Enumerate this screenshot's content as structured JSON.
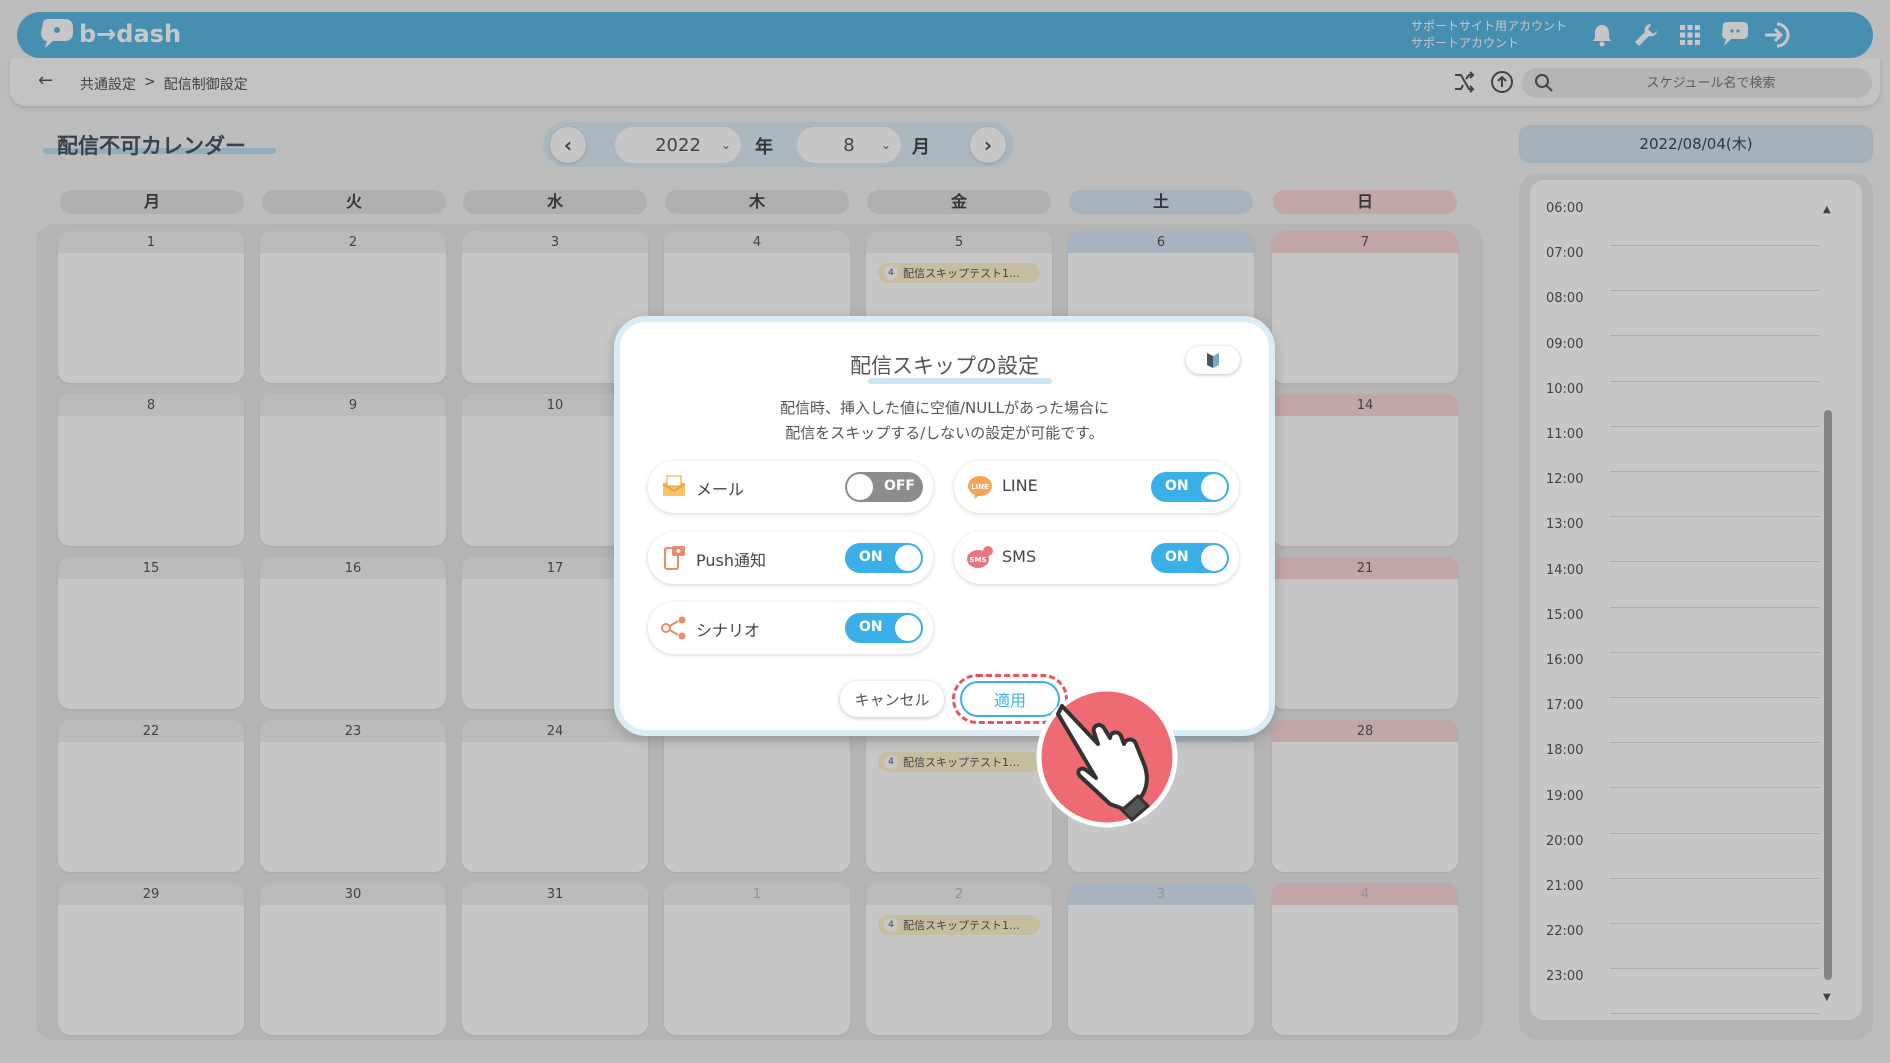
{
  "header": {
    "logo_text": "b→dash",
    "account_line1": "サポートサイト用アカウント",
    "account_line2": "サポートアカウント",
    "icons": [
      "bell-icon",
      "wrench-icon",
      "grid-icon",
      "chat-icon",
      "logout-icon"
    ]
  },
  "breadcrumb": {
    "back_icon": "arrow-left-icon",
    "item1": "共通設定",
    "separator": ">",
    "item2": "配信制御設定"
  },
  "toolbar": {
    "search_placeholder": "スケジュール名で検索"
  },
  "calendar": {
    "title": "配信不可カレンダー",
    "year": "2022",
    "year_label": "年",
    "month": "8",
    "month_label": "月",
    "weekdays": [
      "月",
      "火",
      "水",
      "木",
      "金",
      "土",
      "日"
    ],
    "weeks": [
      [
        {
          "d": "1"
        },
        {
          "d": "2"
        },
        {
          "d": "3"
        },
        {
          "d": "4"
        },
        {
          "d": "5",
          "event": "配信スキップテスト1…",
          "count": "4"
        },
        {
          "d": "6"
        },
        {
          "d": "7"
        }
      ],
      [
        {
          "d": "8"
        },
        {
          "d": "9"
        },
        {
          "d": "10"
        },
        {
          "d": ""
        },
        {
          "d": ""
        },
        {
          "d": ""
        },
        {
          "d": "14"
        }
      ],
      [
        {
          "d": "15"
        },
        {
          "d": "16"
        },
        {
          "d": "17"
        },
        {
          "d": ""
        },
        {
          "d": ""
        },
        {
          "d": ""
        },
        {
          "d": "21"
        }
      ],
      [
        {
          "d": "22"
        },
        {
          "d": "23"
        },
        {
          "d": "24"
        },
        {
          "d": ""
        },
        {
          "d": "",
          "event": "配信スキップテスト1…",
          "count": "4"
        },
        {
          "d": ""
        },
        {
          "d": "28"
        }
      ],
      [
        {
          "d": "29"
        },
        {
          "d": "30"
        },
        {
          "d": "31"
        },
        {
          "d": "1",
          "other": true
        },
        {
          "d": "2",
          "other": true,
          "event": "配信スキップテスト1…",
          "count": "4"
        },
        {
          "d": "3",
          "other": true
        },
        {
          "d": "4",
          "other": true
        }
      ]
    ]
  },
  "schedule": {
    "date": "2022/08/04(木)",
    "hours": [
      "06:00",
      "07:00",
      "08:00",
      "09:00",
      "10:00",
      "11:00",
      "12:00",
      "13:00",
      "14:00",
      "15:00",
      "16:00",
      "17:00",
      "18:00",
      "19:00",
      "20:00",
      "21:00",
      "22:00",
      "23:00"
    ]
  },
  "modal": {
    "title": "配信スキップの設定",
    "desc_line1": "配信時、挿入した値に空値/NULLがあった場合に",
    "desc_line2": "配信をスキップする/しないの設定が可能です。",
    "options": [
      {
        "label": "メール",
        "state": "OFF",
        "icon": "mail-icon"
      },
      {
        "label": "LINE",
        "state": "ON",
        "icon": "line-icon"
      },
      {
        "label": "Push通知",
        "state": "ON",
        "icon": "push-notification-icon"
      },
      {
        "label": "SMS",
        "state": "ON",
        "icon": "sms-icon"
      },
      {
        "label": "シナリオ",
        "state": "ON",
        "icon": "scenario-icon"
      }
    ],
    "cancel_label": "キャンセル",
    "apply_label": "適用"
  },
  "colors": {
    "header": "#5bb8e3",
    "toggle_on": "#3bb0e8",
    "toggle_off": "#8c8c8c",
    "highlight": "#e9535b"
  }
}
